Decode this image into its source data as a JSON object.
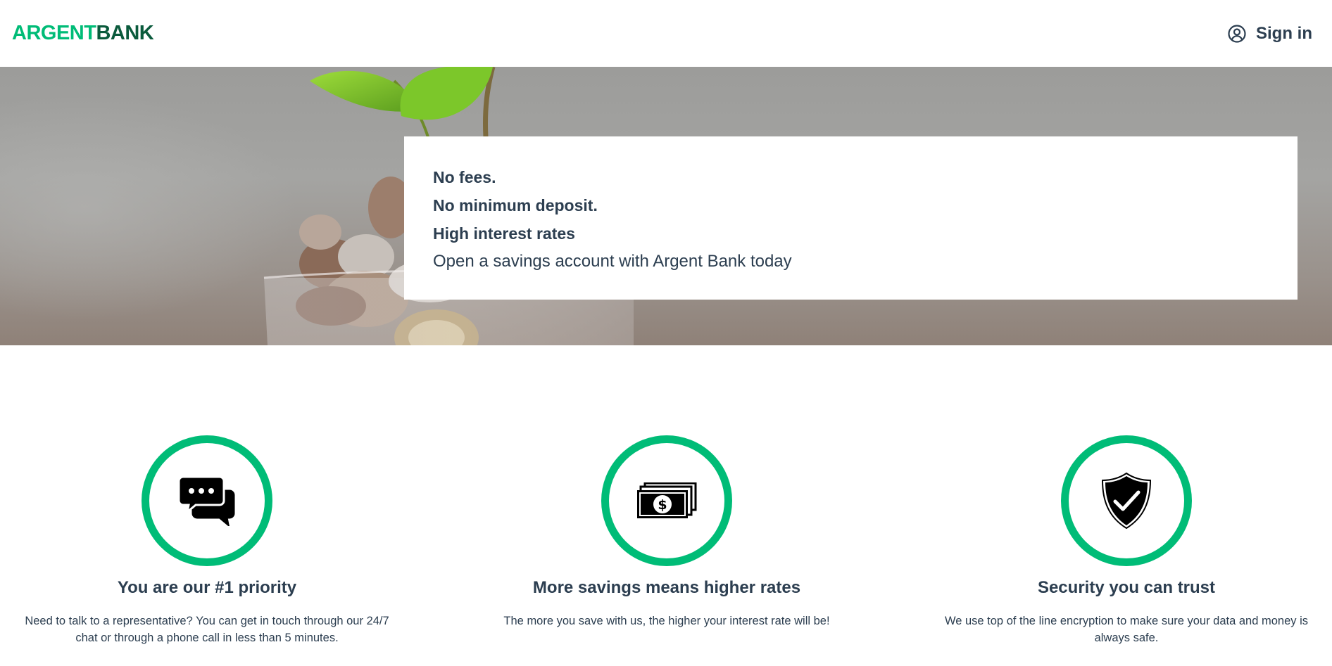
{
  "nav": {
    "logo_part1": "ARGENT",
    "logo_part2": "BANK",
    "signin_label": "Sign in",
    "icon": "user-circle-icon"
  },
  "hero": {
    "subtitles": [
      "No fees.",
      "No minimum deposit.",
      "High interest rates"
    ],
    "text": "Open a savings account with Argent Bank today"
  },
  "features": [
    {
      "icon": "chat-icon",
      "title": "You are our #1 priority",
      "text": "Need to talk to a representative? You can get in touch through our 24/7 chat or through a phone call in less than 5 minutes."
    },
    {
      "icon": "money-icon",
      "title": "More savings means higher rates",
      "text": "The more you save with us, the higher your interest rate will be!"
    },
    {
      "icon": "security-shield-icon",
      "title": "Security you can trust",
      "text": "We use top of the line encryption to make sure your data and money is always safe."
    }
  ],
  "colors": {
    "brand_green": "#00bc77",
    "dark_green": "#0a5a3c",
    "text": "#2c3e50"
  }
}
